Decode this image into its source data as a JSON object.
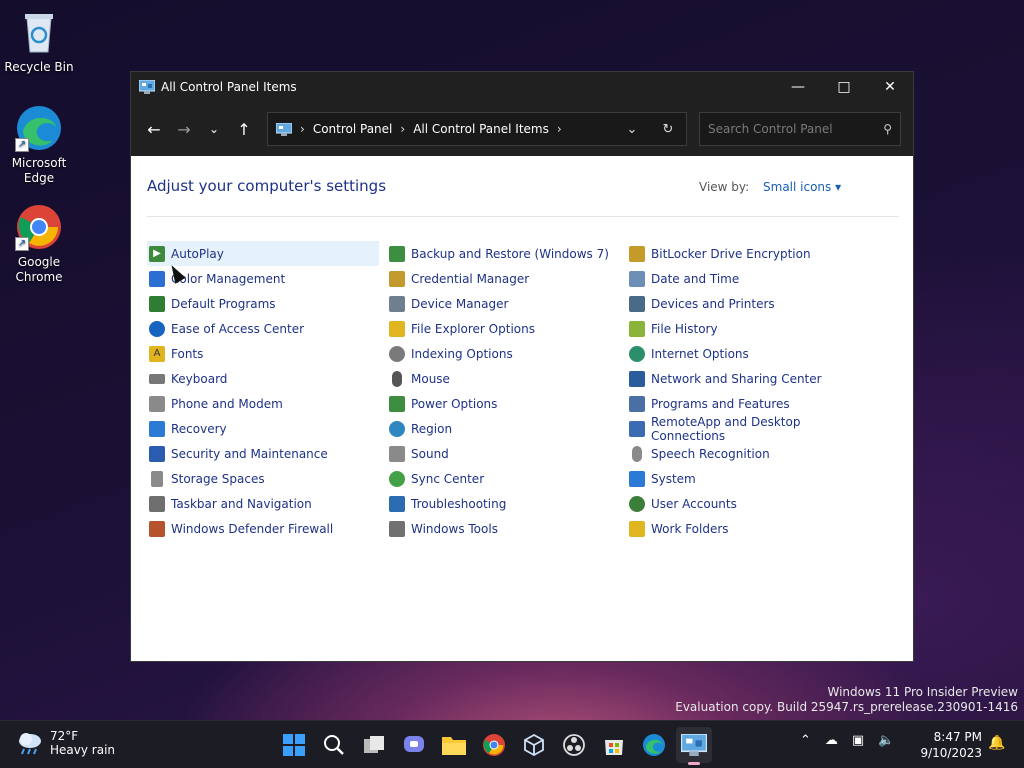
{
  "desktop": {
    "icons": [
      {
        "label": "Recycle Bin"
      },
      {
        "label": "Microsoft Edge"
      },
      {
        "label": "Google Chrome"
      }
    ]
  },
  "window": {
    "title": "All Control Panel Items",
    "address": {
      "crumb1": "Control Panel",
      "crumb2": "All Control Panel Items"
    },
    "search_placeholder": "Search Control Panel",
    "heading": "Adjust your computer's settings",
    "view_by_label": "View by:",
    "view_by_value": "Small icons",
    "columns": [
      [
        {
          "label": "AutoPlay",
          "color": "#3d8a3d"
        },
        {
          "label": "Color Management",
          "color": "#2a6fd1"
        },
        {
          "label": "Default Programs",
          "color": "#2e7d32"
        },
        {
          "label": "Ease of Access Center",
          "color": "#1565c0"
        },
        {
          "label": "Fonts",
          "color": "#e0b520"
        },
        {
          "label": "Keyboard",
          "color": "#777777"
        },
        {
          "label": "Phone and Modem",
          "color": "#8a8a8a"
        },
        {
          "label": "Recovery",
          "color": "#2b7bd6"
        },
        {
          "label": "Security and Maintenance",
          "color": "#2a5db0"
        },
        {
          "label": "Storage Spaces",
          "color": "#8a8a8a"
        },
        {
          "label": "Taskbar and Navigation",
          "color": "#6f6f6f"
        },
        {
          "label": "Windows Defender Firewall",
          "color": "#b5532c"
        }
      ],
      [
        {
          "label": "Backup and Restore (Windows 7)",
          "color": "#3e8e41"
        },
        {
          "label": "Credential Manager",
          "color": "#c29a2e"
        },
        {
          "label": "Device Manager",
          "color": "#6f7f8f"
        },
        {
          "label": "File Explorer Options",
          "color": "#e0b520"
        },
        {
          "label": "Indexing Options",
          "color": "#7a7a7a"
        },
        {
          "label": "Mouse",
          "color": "#555555"
        },
        {
          "label": "Power Options",
          "color": "#3e8e41"
        },
        {
          "label": "Region",
          "color": "#2e86c1"
        },
        {
          "label": "Sound",
          "color": "#8a8a8a"
        },
        {
          "label": "Sync Center",
          "color": "#43a047"
        },
        {
          "label": "Troubleshooting",
          "color": "#2b6cb0"
        },
        {
          "label": "Windows Tools",
          "color": "#707070"
        }
      ],
      [
        {
          "label": "BitLocker Drive Encryption",
          "color": "#c49a2a"
        },
        {
          "label": "Date and Time",
          "color": "#6d8fb5"
        },
        {
          "label": "Devices and Printers",
          "color": "#4a6a8a"
        },
        {
          "label": "File History",
          "color": "#8ab43a"
        },
        {
          "label": "Internet Options",
          "color": "#2a8f6a"
        },
        {
          "label": "Network and Sharing Center",
          "color": "#2b5c9b"
        },
        {
          "label": "Programs and Features",
          "color": "#4a6fa5"
        },
        {
          "label": "RemoteApp and Desktop Connections",
          "color": "#3b6bb0"
        },
        {
          "label": "Speech Recognition",
          "color": "#8a8a8a"
        },
        {
          "label": "System",
          "color": "#2b7bd6"
        },
        {
          "label": "User Accounts",
          "color": "#3a7f3a"
        },
        {
          "label": "Work Folders",
          "color": "#e0b520"
        }
      ]
    ]
  },
  "watermark": {
    "line1": "Windows 11 Pro Insider Preview",
    "line2": "Evaluation copy. Build 25947.rs_prerelease.230901-1416"
  },
  "taskbar": {
    "weather_temp": "72°F",
    "weather_desc": "Heavy rain",
    "time": "8:47 PM",
    "date": "9/10/2023"
  }
}
